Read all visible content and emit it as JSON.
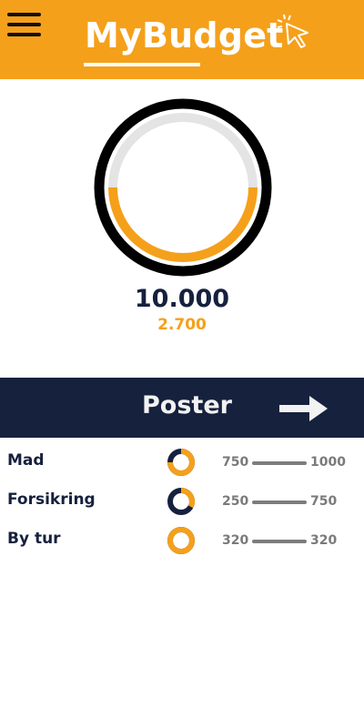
{
  "header": {
    "title": "MyBudget",
    "menu_icon": "hamburger-icon",
    "logo_icon": "cursor-click-icon",
    "background": "#f5a01a"
  },
  "budget": {
    "total": "10.000",
    "spent": "2.700",
    "progress_fraction": 0.5,
    "colors": {
      "fill": "#f5a01a",
      "track": "#e4e4e4",
      "ring": "#000000"
    }
  },
  "poster": {
    "title": "Poster",
    "arrow_icon": "arrow-right-icon",
    "background": "#16213e"
  },
  "items": [
    {
      "label": "Mad",
      "min": "750",
      "max": "1000",
      "fill_fraction": 0.75
    },
    {
      "label": "Forsikring",
      "min": "250",
      "max": "750",
      "fill_fraction": 0.33
    },
    {
      "label": "By tur",
      "min": "320",
      "max": "320",
      "fill_fraction": 1.0
    }
  ]
}
